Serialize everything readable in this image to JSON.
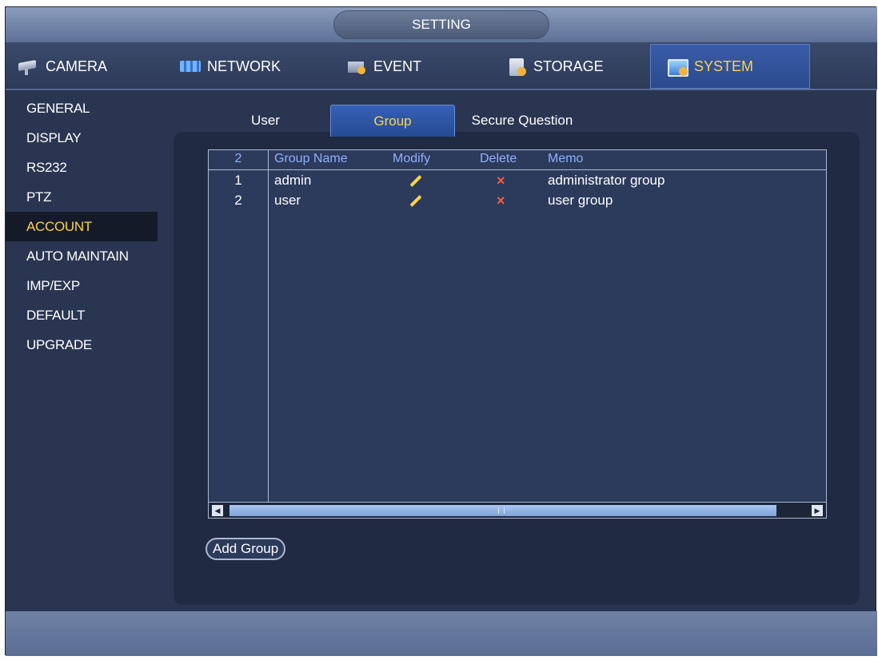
{
  "window": {
    "title": "SETTING"
  },
  "tabs": [
    {
      "label": "CAMERA",
      "icon": "camera-icon"
    },
    {
      "label": "NETWORK",
      "icon": "network-icon"
    },
    {
      "label": "EVENT",
      "icon": "event-icon"
    },
    {
      "label": "STORAGE",
      "icon": "storage-icon"
    },
    {
      "label": "SYSTEM",
      "icon": "system-icon",
      "active": true
    }
  ],
  "sidebar": {
    "items": [
      {
        "label": "GENERAL"
      },
      {
        "label": "DISPLAY"
      },
      {
        "label": "RS232"
      },
      {
        "label": "PTZ"
      },
      {
        "label": "ACCOUNT",
        "active": true
      },
      {
        "label": "AUTO MAINTAIN"
      },
      {
        "label": "IMP/EXP"
      },
      {
        "label": "DEFAULT"
      },
      {
        "label": "UPGRADE"
      }
    ]
  },
  "subtabs": [
    {
      "label": "User"
    },
    {
      "label": "Group",
      "active": true
    },
    {
      "label": "Secure Question"
    }
  ],
  "table": {
    "count": "2",
    "headers": {
      "name": "Group Name",
      "modify": "Modify",
      "delete": "Delete",
      "memo": "Memo"
    },
    "rows": [
      {
        "index": "1",
        "name": "admin",
        "memo": "administrator group"
      },
      {
        "index": "2",
        "name": "user",
        "memo": "user group"
      }
    ]
  },
  "buttons": {
    "add_group": "Add Group"
  },
  "colors": {
    "background": "#2a3552",
    "active_text": "#ffd24a",
    "header_text": "#8fb0ff",
    "delete_mark": "#ff5a3a"
  }
}
